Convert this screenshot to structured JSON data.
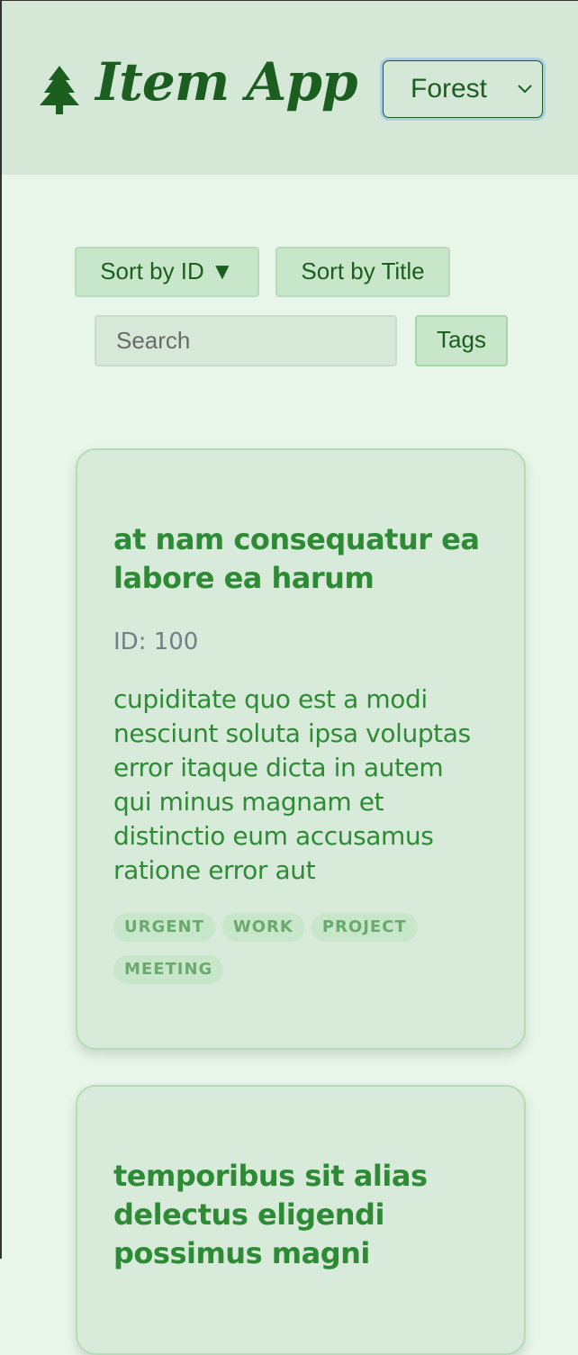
{
  "header": {
    "title": "Item App",
    "logo_icon": "tree-icon",
    "theme_select": {
      "value": "Forest",
      "icon": "chevron-down-icon"
    }
  },
  "controls": {
    "sort_id_label": "Sort by ID ▼",
    "sort_title_label": "Sort by Title",
    "search_placeholder": "Search",
    "search_value": "",
    "tags_label": "Tags"
  },
  "colors": {
    "accent": "#1b5e20",
    "card_title": "#2e8b35",
    "background": "#e8f5e9",
    "header_bg": "#d5e8d7"
  },
  "items": [
    {
      "title": "at nam consequatur ea labore ea harum",
      "id_label": "ID: 100",
      "body": "cupiditate quo est a modi nesciunt soluta ipsa voluptas error itaque dicta in autem qui minus magnam et distinctio eum accusamus ratione error aut",
      "tags": [
        "URGENT",
        "WORK",
        "PROJECT",
        "MEETING"
      ]
    },
    {
      "title": "temporibus sit alias delectus eligendi possimus magni"
    }
  ]
}
